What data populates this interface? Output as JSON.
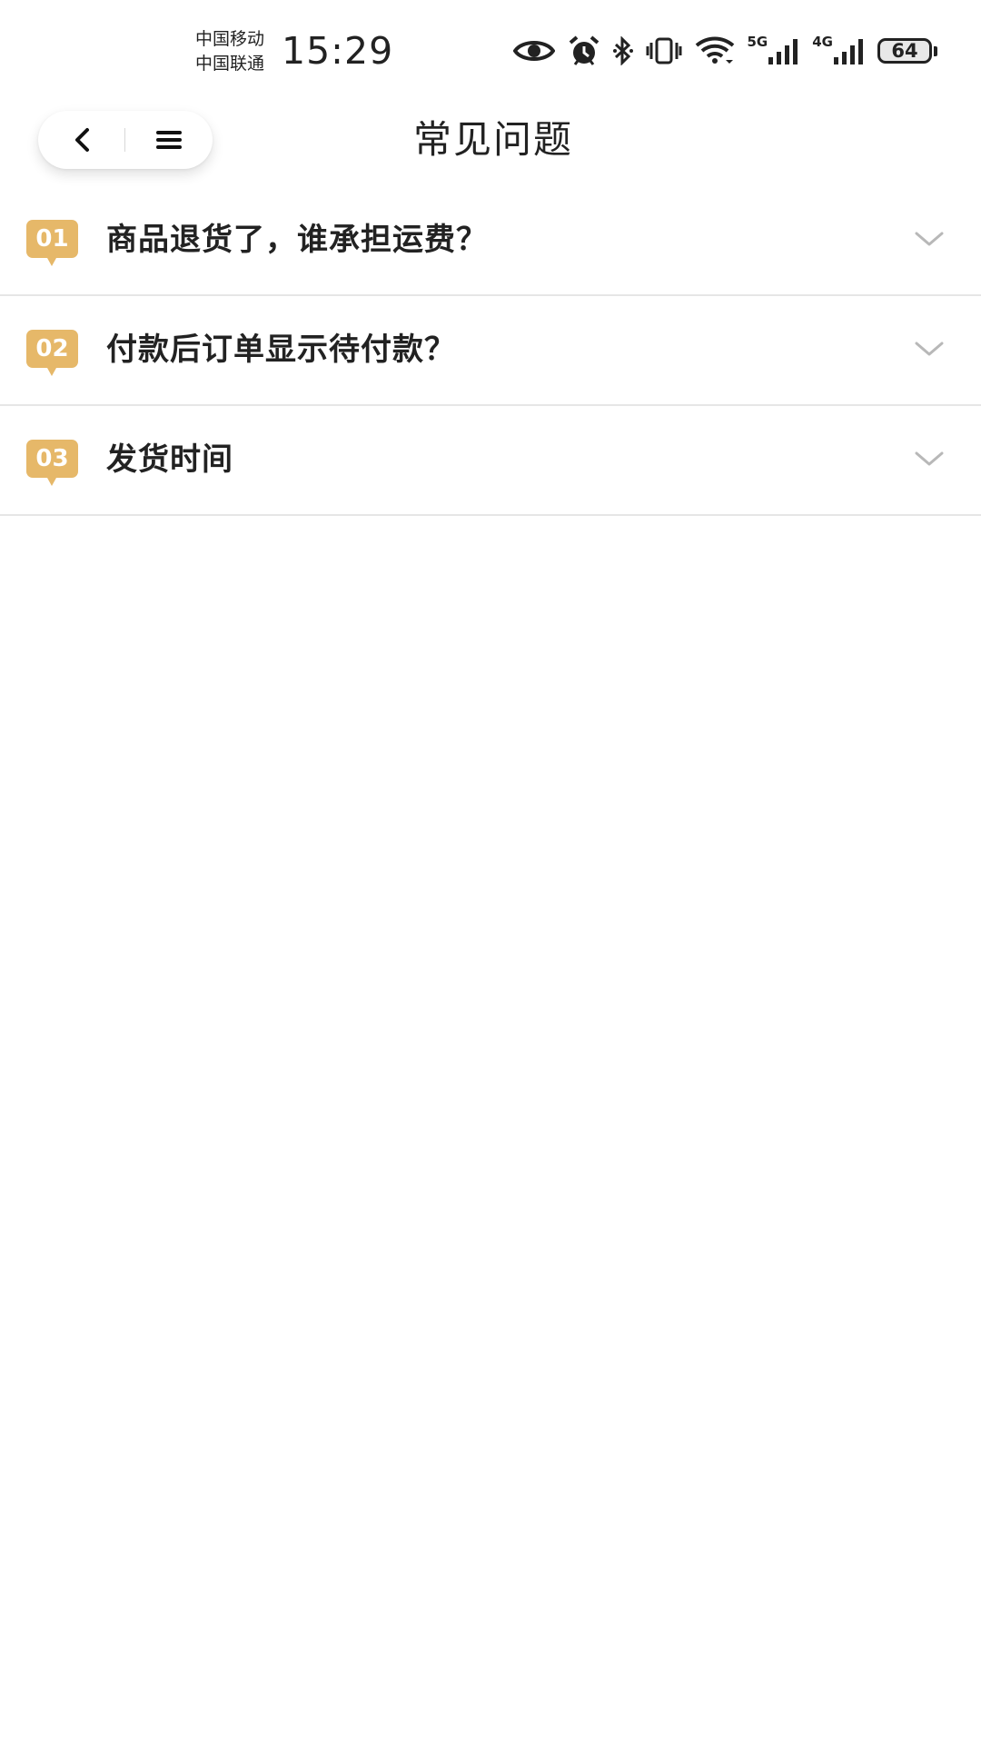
{
  "status_bar": {
    "carrier_1": "中国移动",
    "carrier_2": "中国联通",
    "time": "15:29",
    "net_1": "5G",
    "net_2": "4G",
    "battery": "64",
    "icons": [
      "eye-icon",
      "alarm-icon",
      "bluetooth-icon",
      "vibrate-icon",
      "wifi-icon",
      "signal-icon",
      "signal-icon",
      "battery-icon"
    ]
  },
  "nav": {
    "title": "常见问题",
    "back_icon": "chevron-left-icon",
    "menu_icon": "menu-icon"
  },
  "faq": {
    "items": [
      {
        "number": "01",
        "question": "商品退货了，谁承担运费？"
      },
      {
        "number": "02",
        "question": "付款后订单显示待付款？"
      },
      {
        "number": "03",
        "question": "发货时间"
      }
    ]
  },
  "colors": {
    "badge": "#e6b869",
    "divider": "#e6e6e6",
    "chevron": "#b8b8b8",
    "text": "#222222"
  }
}
